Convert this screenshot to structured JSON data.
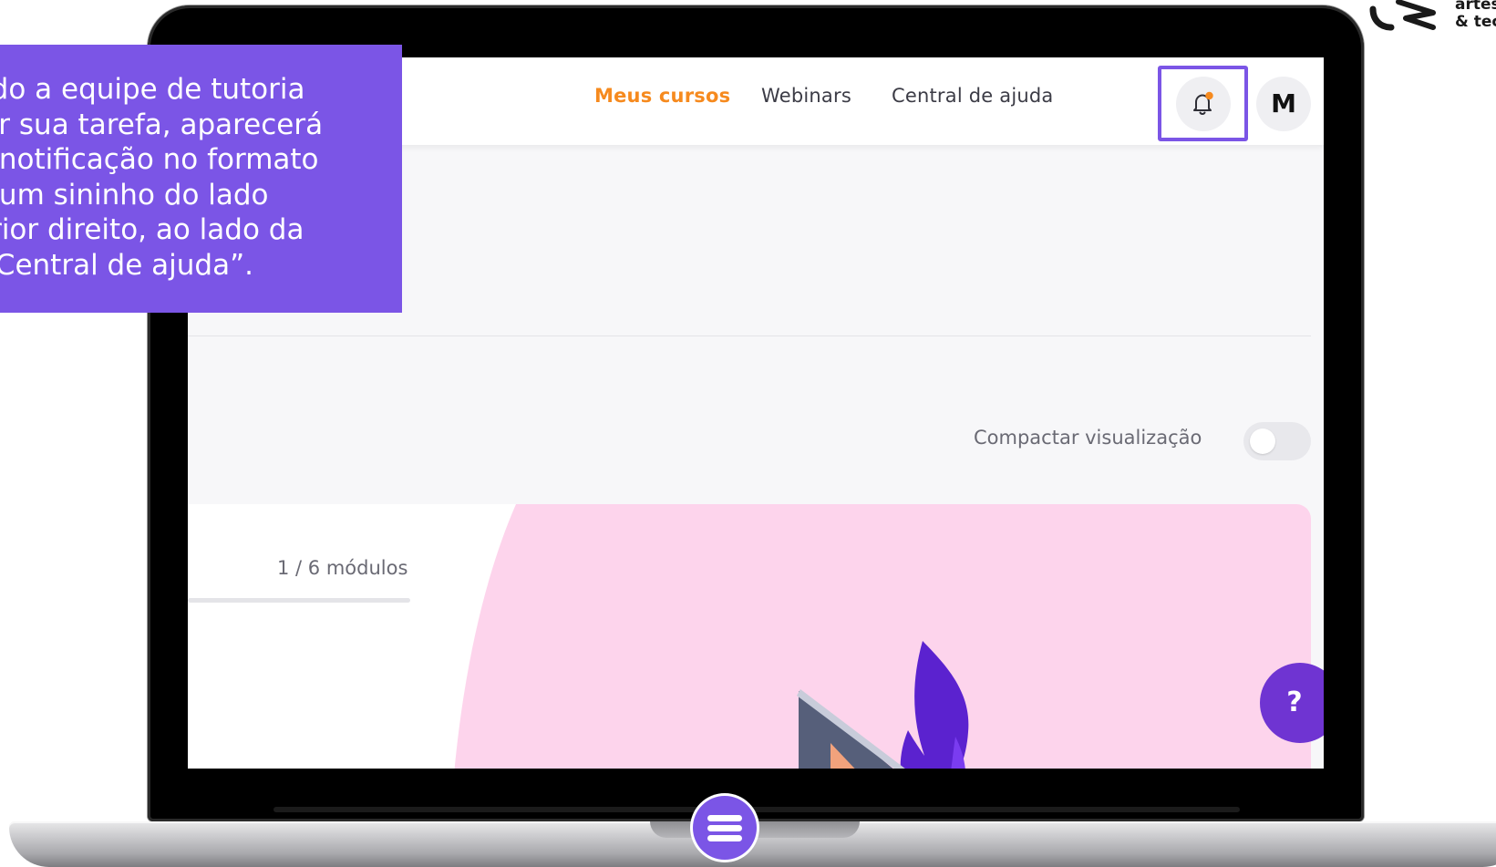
{
  "nav": {
    "links": [
      "Meus cursos",
      "Webinars",
      "Central de ajuda"
    ],
    "active_index": 0,
    "avatar_initial": "M"
  },
  "view_options": {
    "compact_label": "Compactar visualização",
    "compact_enabled": false
  },
  "course": {
    "modules_progress": "1 / 6 módulos"
  },
  "help_button": {
    "label": "?"
  },
  "callout": {
    "text": "ndo a equipe de tutoria\ngir sua tarefa, aparecerá\na notificação no formato\ne um sininho do lado\nerior direito, ao lado da\n “Central de ajuda”."
  },
  "logo": {
    "text": "artes\n& tec"
  },
  "colors": {
    "accent_purple": "#7b55e6",
    "fab_purple": "#6f34d2",
    "nav_active": "#f68a1e",
    "notification_dot": "#f68a1e",
    "card_pink": "#fdd4ec"
  },
  "icons": {
    "bell": "bell-icon",
    "menu": "hamburger-icon"
  }
}
